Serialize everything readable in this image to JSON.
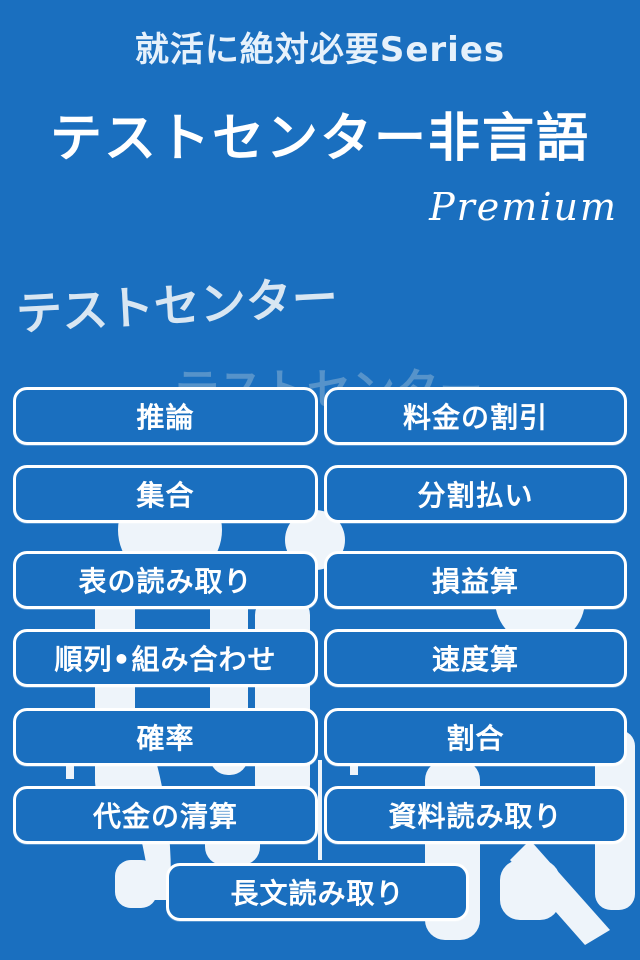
{
  "header": {
    "subtitle": "就活に絶対必要Series",
    "title": "テストセンター非言語",
    "edition": "Premium"
  },
  "section": {
    "heading": "テストセンター",
    "ghost_heading": "テストセンター"
  },
  "menu": {
    "items": [
      "推論",
      "料金の割引",
      "集合",
      "分割払い",
      "表の読み取り",
      "損益算",
      "順列•組み合わせ",
      "速度算",
      "確率",
      "割合",
      "代金の清算",
      "資料読み取り",
      "長文読み取り"
    ]
  },
  "colors": {
    "background": "#1a6fbf",
    "button_border": "#ffffff",
    "text": "#ffffff"
  }
}
